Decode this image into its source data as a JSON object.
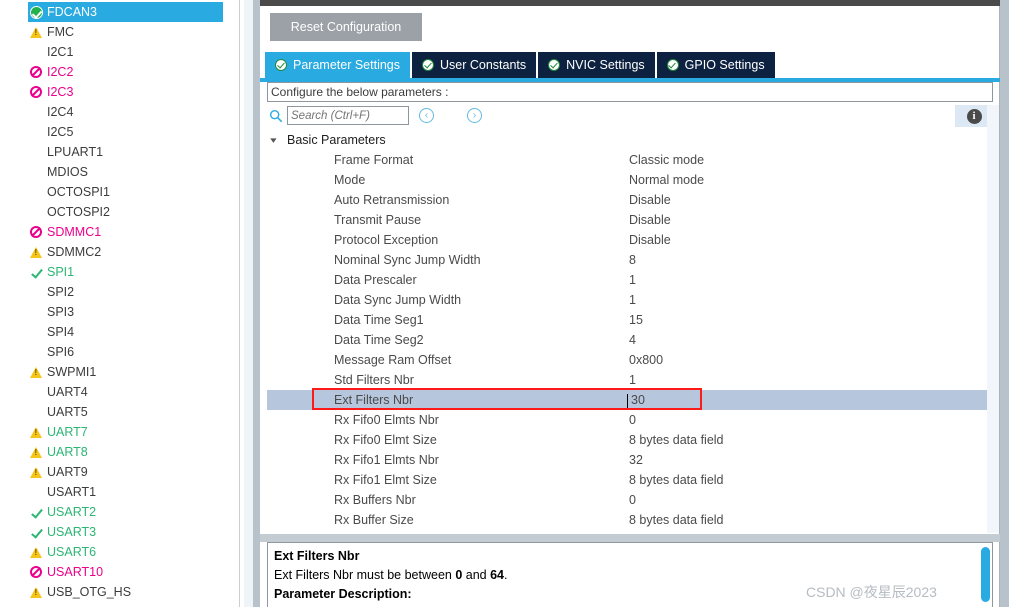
{
  "sidebar": {
    "items": [
      {
        "label": "FDCAN3",
        "icon": "check-circle-icon",
        "state": "selected",
        "color": "#ffffff"
      },
      {
        "label": "FMC",
        "icon": "warning-triangle-icon",
        "state": "warn",
        "color": "#3c3c3c"
      },
      {
        "label": "I2C1",
        "icon": "none",
        "state": "plain",
        "color": "#3c3c3c"
      },
      {
        "label": "I2C2",
        "icon": "deny-icon",
        "state": "error",
        "color": "#ec008c"
      },
      {
        "label": "I2C3",
        "icon": "deny-icon",
        "state": "error",
        "color": "#ec008c"
      },
      {
        "label": "I2C4",
        "icon": "none",
        "state": "plain",
        "color": "#3c3c3c"
      },
      {
        "label": "I2C5",
        "icon": "none",
        "state": "plain",
        "color": "#3c3c3c"
      },
      {
        "label": "LPUART1",
        "icon": "none",
        "state": "plain",
        "color": "#3c3c3c"
      },
      {
        "label": "MDIOS",
        "icon": "none",
        "state": "plain",
        "color": "#3c3c3c"
      },
      {
        "label": "OCTOSPI1",
        "icon": "none",
        "state": "plain",
        "color": "#3c3c3c"
      },
      {
        "label": "OCTOSPI2",
        "icon": "none",
        "state": "plain",
        "color": "#3c3c3c"
      },
      {
        "label": "SDMMC1",
        "icon": "deny-icon",
        "state": "error",
        "color": "#ec008c"
      },
      {
        "label": "SDMMC2",
        "icon": "warning-triangle-icon",
        "state": "warn",
        "color": "#3c3c3c"
      },
      {
        "label": "SPI1",
        "icon": "tick-icon",
        "state": "ok",
        "color": "#2bb673"
      },
      {
        "label": "SPI2",
        "icon": "none",
        "state": "plain",
        "color": "#3c3c3c"
      },
      {
        "label": "SPI3",
        "icon": "none",
        "state": "plain",
        "color": "#3c3c3c"
      },
      {
        "label": "SPI4",
        "icon": "none",
        "state": "plain",
        "color": "#3c3c3c"
      },
      {
        "label": "SPI6",
        "icon": "none",
        "state": "plain",
        "color": "#3c3c3c"
      },
      {
        "label": "SWPMI1",
        "icon": "warning-triangle-icon",
        "state": "warn",
        "color": "#3c3c3c"
      },
      {
        "label": "UART4",
        "icon": "none",
        "state": "plain",
        "color": "#3c3c3c"
      },
      {
        "label": "UART5",
        "icon": "none",
        "state": "plain",
        "color": "#3c3c3c"
      },
      {
        "label": "UART7",
        "icon": "warning-triangle-icon",
        "state": "warn",
        "color": "#2bb673"
      },
      {
        "label": "UART8",
        "icon": "warning-triangle-icon",
        "state": "warn",
        "color": "#2bb673"
      },
      {
        "label": "UART9",
        "icon": "warning-triangle-icon",
        "state": "warn",
        "color": "#3c3c3c"
      },
      {
        "label": "USART1",
        "icon": "none",
        "state": "plain",
        "color": "#3c3c3c"
      },
      {
        "label": "USART2",
        "icon": "tick-icon",
        "state": "ok",
        "color": "#2bb673"
      },
      {
        "label": "USART3",
        "icon": "tick-icon",
        "state": "ok",
        "color": "#2bb673"
      },
      {
        "label": "USART6",
        "icon": "warning-triangle-icon",
        "state": "warn",
        "color": "#2bb673"
      },
      {
        "label": "USART10",
        "icon": "deny-icon",
        "state": "error",
        "color": "#ec008c"
      },
      {
        "label": "USB_OTG_HS",
        "icon": "warning-triangle-icon",
        "state": "warn",
        "color": "#3c3c3c"
      }
    ]
  },
  "toolbar": {
    "reset_label": "Reset Configuration"
  },
  "tabs": [
    {
      "label": "Parameter Settings",
      "active": true
    },
    {
      "label": "User Constants",
      "active": false
    },
    {
      "label": "NVIC Settings",
      "active": false
    },
    {
      "label": "GPIO Settings",
      "active": false
    }
  ],
  "configure": {
    "banner": "Configure the below parameters :"
  },
  "search": {
    "placeholder": "Search (Ctrl+F)",
    "value": "",
    "prev_glyph": "‹",
    "next_glyph": "›",
    "info_glyph": "i"
  },
  "parameters": {
    "group_label": "Basic Parameters",
    "rows": [
      {
        "name": "Frame Format",
        "value": "Classic mode",
        "selected": false
      },
      {
        "name": "Mode",
        "value": "Normal mode",
        "selected": false
      },
      {
        "name": "Auto Retransmission",
        "value": "Disable",
        "selected": false
      },
      {
        "name": "Transmit Pause",
        "value": "Disable",
        "selected": false
      },
      {
        "name": "Protocol Exception",
        "value": "Disable",
        "selected": false
      },
      {
        "name": "Nominal Sync Jump Width",
        "value": "8",
        "selected": false
      },
      {
        "name": "Data Prescaler",
        "value": "1",
        "selected": false
      },
      {
        "name": "Data Sync Jump Width",
        "value": "1",
        "selected": false
      },
      {
        "name": "Data Time Seg1",
        "value": "15",
        "selected": false
      },
      {
        "name": "Data Time Seg2",
        "value": "4",
        "selected": false
      },
      {
        "name": "Message Ram Offset",
        "value": "0x800",
        "selected": false
      },
      {
        "name": "Std Filters Nbr",
        "value": "1",
        "selected": false
      },
      {
        "name": "Ext Filters Nbr",
        "value": "30",
        "selected": true
      },
      {
        "name": "Rx Fifo0 Elmts Nbr",
        "value": "0",
        "selected": false
      },
      {
        "name": "Rx Fifo0 Elmt Size",
        "value": "8 bytes data field",
        "selected": false
      },
      {
        "name": "Rx Fifo1 Elmts Nbr",
        "value": "32",
        "selected": false
      },
      {
        "name": "Rx Fifo1 Elmt Size",
        "value": "8 bytes data field",
        "selected": false
      },
      {
        "name": "Rx Buffers Nbr",
        "value": "0",
        "selected": false
      },
      {
        "name": "Rx Buffer Size",
        "value": "8 bytes data field",
        "selected": false
      }
    ]
  },
  "description": {
    "title": "Ext Filters Nbr",
    "constraint_prefix": "Ext Filters Nbr must be between ",
    "constraint_min": "0",
    "constraint_mid": " and ",
    "constraint_max": "64",
    "constraint_suffix": ".",
    "param_desc_label": "Parameter Description:"
  },
  "watermark": {
    "text": "CSDN @夜星辰2023"
  }
}
